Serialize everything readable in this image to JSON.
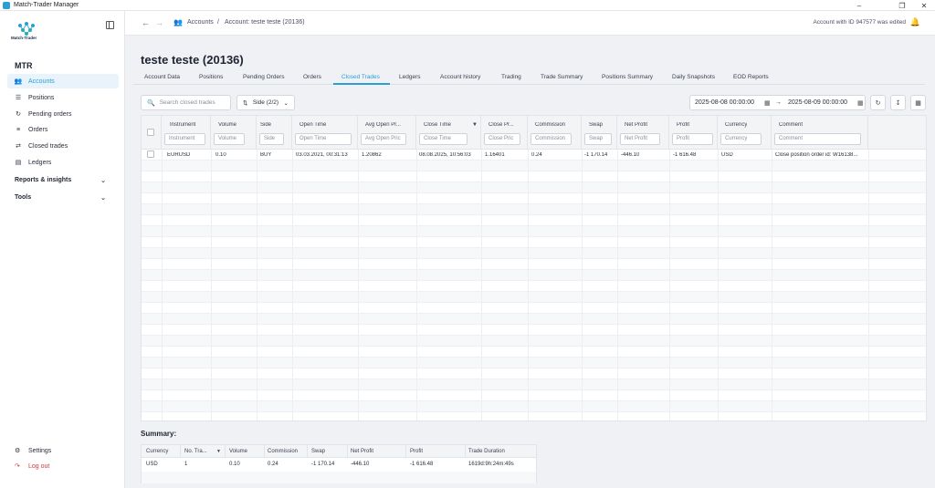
{
  "window": {
    "title": "Match-Trader Manager",
    "minimize": "–",
    "maximize": "❐",
    "close": "✕"
  },
  "sidebar": {
    "logo_text": "Match-Trader",
    "brand": "MTR",
    "items": [
      {
        "label": "Accounts",
        "icon": "users-icon"
      },
      {
        "label": "Positions",
        "icon": "list-icon"
      },
      {
        "label": "Pending orders",
        "icon": "pending-icon"
      },
      {
        "label": "Orders",
        "icon": "orders-icon"
      },
      {
        "label": "Closed trades",
        "icon": "closed-trades-icon"
      },
      {
        "label": "Ledgers",
        "icon": "ledger-icon"
      }
    ],
    "sections": [
      {
        "label": "Reports & insights"
      },
      {
        "label": "Tools"
      }
    ],
    "bottom": {
      "settings": "Settings",
      "logout": "Log out"
    }
  },
  "topbar": {
    "crumb_root": "Accounts",
    "crumb_sep": "/",
    "crumb_current": "Account: teste teste (20136)",
    "notice": "Account with ID 947577 was edited"
  },
  "page": {
    "title": "teste teste (20136)"
  },
  "tabs": [
    "Account Data",
    "Positions",
    "Pending Orders",
    "Orders",
    "Closed Trades",
    "Ledgers",
    "Account history",
    "Trading",
    "Trade Summary",
    "Positions Summary",
    "Daily Snapshots",
    "EOD Reports"
  ],
  "active_tab": "Closed Trades",
  "toolbar": {
    "search_placeholder": "Search closed trades",
    "side_filter": "Side (2/2)",
    "date_from": "2025-08-08 00:00:00",
    "date_to": "2025-08-09 00:00:00"
  },
  "table": {
    "columns": [
      {
        "label": "Instrument",
        "filter": "Instrument"
      },
      {
        "label": "Volume",
        "filter": "Volume"
      },
      {
        "label": "Side",
        "filter": "Side"
      },
      {
        "label": "Open Time",
        "filter": "Open Time"
      },
      {
        "label": "Avg Open Pr...",
        "filter": "Avg Open Pric"
      },
      {
        "label": "Close Time",
        "filter": "Close Time"
      },
      {
        "label": "Close Pr...",
        "filter": "Close Pric"
      },
      {
        "label": "Commission",
        "filter": "Commission"
      },
      {
        "label": "Swap",
        "filter": "Swap"
      },
      {
        "label": "Net Profit",
        "filter": "Net Profit"
      },
      {
        "label": "Profit",
        "filter": "Profit"
      },
      {
        "label": "Currency",
        "filter": "Currency"
      },
      {
        "label": "Comment",
        "filter": "Comment"
      }
    ],
    "rows": [
      [
        "EURUSD",
        "0.10",
        "BUY",
        "03.03.2021, 00:31:13",
        "1.20862",
        "08.08.2025, 10:56:03",
        "1.16401",
        "0.24",
        "-1 170.14",
        "-446.10",
        "-1 616.48",
        "USD",
        "Close position order id: W16138..."
      ]
    ]
  },
  "summary": {
    "title": "Summary:",
    "columns": [
      "Currency",
      "No. Tra...",
      "Volume",
      "Commission",
      "Swap",
      "Net Profit",
      "Profit",
      "Trade Duration"
    ],
    "values": [
      "USD",
      "1",
      "0.10",
      "0.24",
      "-1 170.14",
      "-446.10",
      "-1 616.48",
      "1619d:9h:24m:49s"
    ]
  },
  "colors": {
    "accent": "#2a9fd6",
    "logout": "#d9363e"
  }
}
